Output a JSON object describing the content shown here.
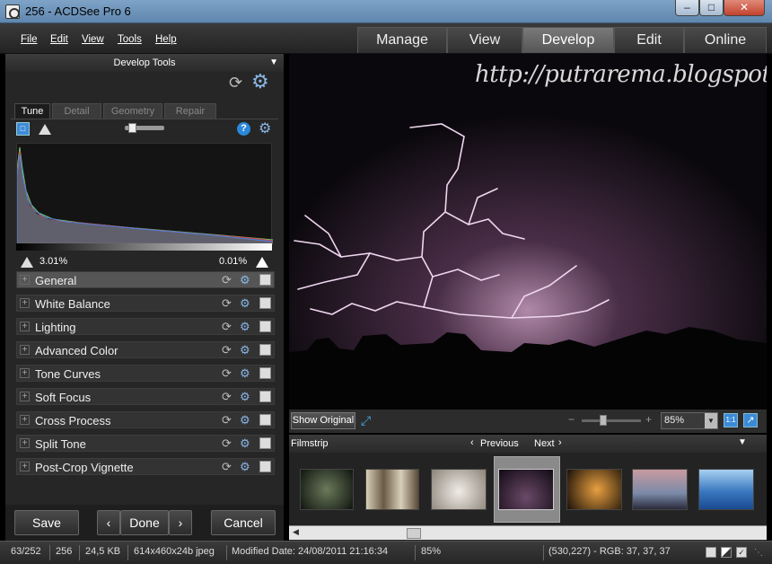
{
  "window": {
    "title": "256 - ACDSee Pro 6",
    "minimize": "–",
    "maximize": "□",
    "close": "✕"
  },
  "menu": [
    {
      "label": "File"
    },
    {
      "label": "Edit"
    },
    {
      "label": "View"
    },
    {
      "label": "Tools"
    },
    {
      "label": "Help"
    }
  ],
  "modes": [
    {
      "label": "Manage",
      "active": false
    },
    {
      "label": "View",
      "active": false
    },
    {
      "label": "Develop",
      "active": true
    },
    {
      "label": "Edit",
      "active": false
    },
    {
      "label": "Online",
      "active": false
    }
  ],
  "develop_tools": {
    "header": "Develop Tools",
    "tabs": [
      {
        "label": "Tune",
        "active": true
      },
      {
        "label": "Detail",
        "active": false
      },
      {
        "label": "Geometry",
        "active": false
      },
      {
        "label": "Repair",
        "active": false
      }
    ],
    "clip_low": "3.01%",
    "clip_high": "0.01%",
    "groups": [
      {
        "label": "General"
      },
      {
        "label": "White Balance"
      },
      {
        "label": "Lighting"
      },
      {
        "label": "Advanced Color"
      },
      {
        "label": "Tone Curves"
      },
      {
        "label": "Soft Focus"
      },
      {
        "label": "Cross Process"
      },
      {
        "label": "Split Tone"
      },
      {
        "label": "Post-Crop Vignette"
      }
    ],
    "save_label": "Save",
    "prev_label": "‹",
    "done_label": "Done",
    "next_label": "›",
    "cancel_label": "Cancel"
  },
  "image": {
    "watermark": "http://putrarema.blogspot.com"
  },
  "image_toolbar": {
    "show_original": "Show Original",
    "zoom": "85%",
    "zoom_minus": "−",
    "zoom_plus": "+",
    "one_to_one": "1:1"
  },
  "filmstrip": {
    "title": "Filmstrip",
    "previous": "Previous",
    "next": "Next",
    "thumbs": [
      {
        "name": "thumb-dragon",
        "color": "#2a3a2e",
        "selected": false
      },
      {
        "name": "thumb-wolves",
        "color": "#8a7a62",
        "selected": false
      },
      {
        "name": "thumb-wolf",
        "color": "#b8b2a8",
        "selected": false
      },
      {
        "name": "thumb-lightning",
        "color": "#1a1020",
        "selected": true
      },
      {
        "name": "thumb-figure",
        "color": "#d08030",
        "selected": false
      },
      {
        "name": "thumb-sunset",
        "color": "#8c6a76",
        "selected": false
      },
      {
        "name": "thumb-sea",
        "color": "#3c7cc4",
        "selected": false
      }
    ]
  },
  "status": {
    "index": "63/252",
    "name": "256",
    "size": "24,5 KB",
    "dims": "614x460x24b jpeg",
    "modified": "Modified Date: 24/08/2011 21:16:34",
    "zoom": "85%",
    "pixel": "(530,227) - RGB: 37, 37, 37"
  }
}
